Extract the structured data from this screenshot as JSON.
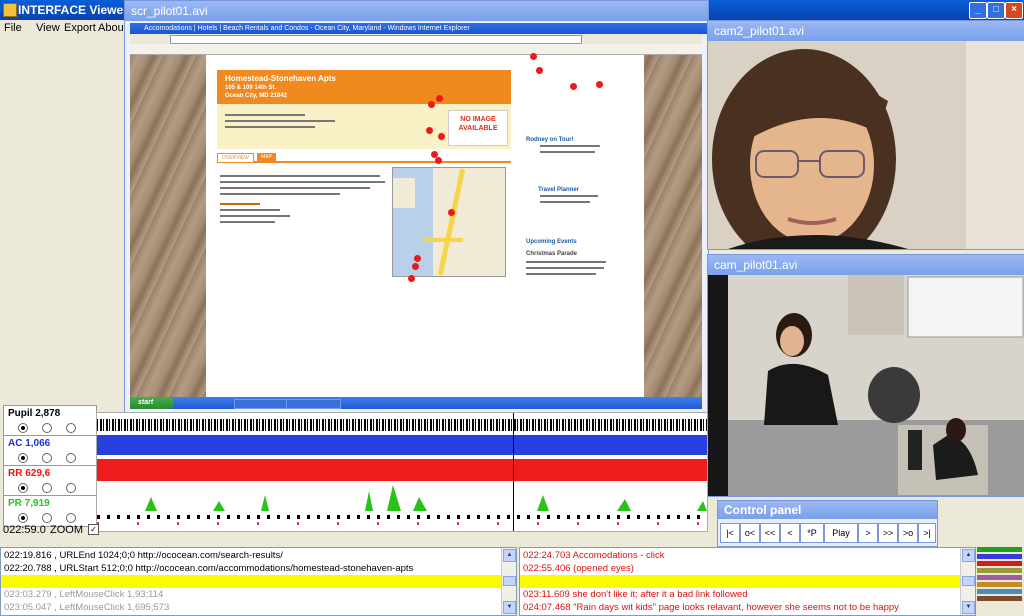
{
  "app": {
    "title": "INTERFACE Viewer C:"
  },
  "window_controls": {
    "minimize": "_",
    "maximize": "□",
    "close": "×"
  },
  "menu": [
    "File",
    "View",
    "Export",
    "About"
  ],
  "scr_window": {
    "title": "scr_pilot01.avi",
    "browser_title": "Accomodations | Hotels | Beach Rentals and Condos - Ocean City, Maryland - Windows Internet Explorer",
    "listing_name": "Homestead-Stonehaven Apts",
    "listing_address1": "105 & 109 14th St.",
    "listing_address2": "Ocean City, MD 21842",
    "no_image": "NO IMAGE AVAILABLE",
    "tab_overview": "OVERVIEW",
    "tab_map": "MAP",
    "sidebar_title1": "Rodney on Tour!",
    "sidebar_title2": "Travel Planner",
    "sidebar_title3": "Upcoming Events",
    "sidebar_title4": "Christmas Parade",
    "start_label": "start"
  },
  "cam2_window": {
    "title": "cam2_pilot01.avi"
  },
  "cam_window": {
    "title": "cam_pilot01.avi"
  },
  "signals": [
    {
      "label": "Pupil 2,878",
      "color": "#000000"
    },
    {
      "label": "AC 1,066",
      "color": "#1c33d6"
    },
    {
      "label": "RR 629,6",
      "color": "#e81414"
    },
    {
      "label": "PR 7,919",
      "color": "#28c21a"
    }
  ],
  "timeline": {
    "time": "022:59.0",
    "zoom_label": "ZOOM",
    "zoom_checked": "✓"
  },
  "control_panel": {
    "title": "Control panel",
    "buttons": [
      "|<",
      "o<",
      "<<",
      "<",
      "*P",
      "Play",
      ">",
      ">>",
      ">o",
      ">|"
    ]
  },
  "log_left": {
    "rows": [
      {
        "text": "022:19.816 , URLEnd 1024;0;0 http://ococean.com/search-results/",
        "color": "#000000"
      },
      {
        "text": "022:20.788 , URLStart 512;0;0 http://ococean.com/accommodations/homestead-stonehaven-apts",
        "color": "#000000"
      },
      {
        "text": "",
        "color": "#000000"
      },
      {
        "text": "023:03.279 , LeftMouseClick 1,93;114",
        "color": "#9a9a9a"
      },
      {
        "text": "023:05.047 , LeftMouseClick 1,695;573",
        "color": "#9a9a9a"
      }
    ]
  },
  "log_right": {
    "rows": [
      {
        "text": "022:24.703  Accomodations - click",
        "color": "#e01010"
      },
      {
        "text": "022:55.406  (opened eyes)",
        "color": "#e01010"
      },
      {
        "text": "",
        "color": "#e01010"
      },
      {
        "text": "023:11.609  she don't like it; after it a bad link followed",
        "color": "#e01010"
      },
      {
        "text": "024:07.468  \"Rain days wit kids\" page looks relavant, however she seems not to be happy",
        "color": "#e01010"
      }
    ]
  },
  "legend_colors": [
    "#1aa31a",
    "#3a3adf",
    "#d41c1c",
    "#9a9a3a",
    "#a05ca0",
    "#c58c2c",
    "#4c8cc0",
    "#7c4c2c"
  ]
}
